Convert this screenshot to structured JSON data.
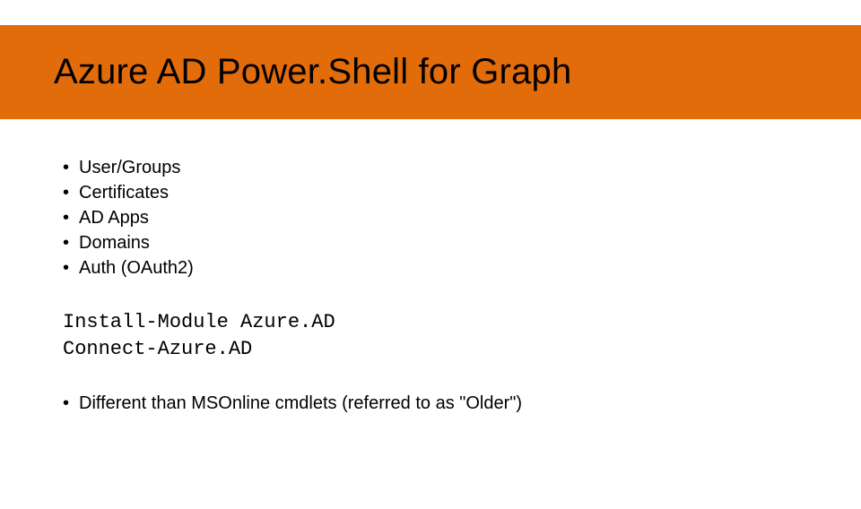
{
  "title": "Azure AD Power.Shell for Graph",
  "bullets": [
    "User/Groups",
    "Certificates",
    "AD Apps",
    "Domains",
    "Auth (OAuth2)"
  ],
  "code": [
    "Install-Module Azure.AD",
    "Connect-Azure.AD"
  ],
  "notes": [
    "Different than MSOnline cmdlets (referred to as \"Older\")"
  ]
}
